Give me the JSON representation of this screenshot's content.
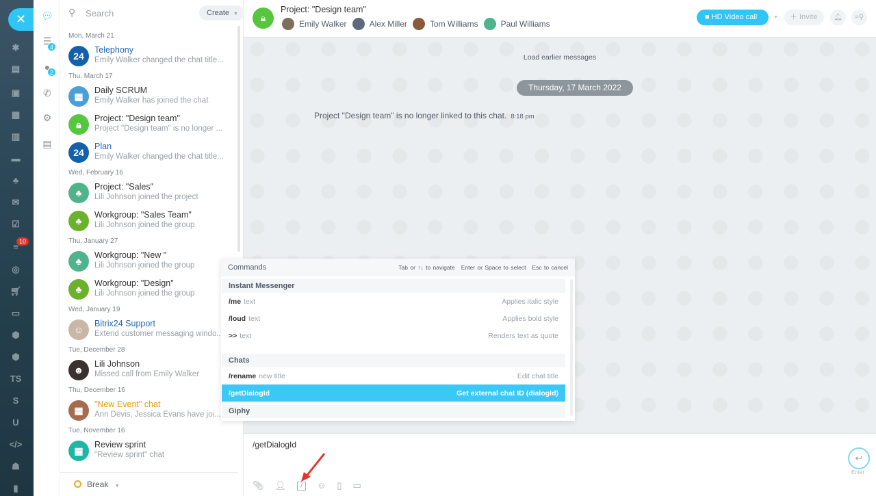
{
  "rail": {
    "close_icon": "close-icon",
    "badge": "10",
    "letters": [
      "TS",
      "S",
      "U"
    ]
  },
  "icon_column": {
    "items": [
      {
        "icon": "chat-icon"
      },
      {
        "icon": "notifications-icon",
        "count": "4"
      },
      {
        "icon": "openlines-icon",
        "count": "2"
      },
      {
        "icon": "phone-icon"
      },
      {
        "icon": "gear-icon"
      },
      {
        "icon": "export-icon"
      }
    ]
  },
  "list": {
    "search_placeholder": "Search",
    "create_label": "Create",
    "groups": [
      {
        "date": "Mon, March 21",
        "items": [
          {
            "title": "Telephony",
            "subtitle": "Emily Walker changed the chat title...",
            "avatar": "24",
            "color": "#1361ae",
            "title_style": "blue"
          }
        ]
      },
      {
        "date": "Thu, March 17",
        "items": [
          {
            "title": "Daily SCRUM",
            "subtitle": "Emily Walker has joined the chat",
            "avatar": "calendar",
            "color": "#4a9fd9"
          },
          {
            "title": "Project: \"Design team\"",
            "subtitle": "Project \"Design team\" is no longer ...",
            "avatar": "lock",
            "color": "#55c63d"
          },
          {
            "title": "Plan",
            "subtitle": "Emily Walker changed the chat title...",
            "avatar": "24",
            "color": "#1361ae",
            "title_style": "blue"
          }
        ]
      },
      {
        "date": "Wed, February 16",
        "items": [
          {
            "title": "Project: \"Sales\"",
            "subtitle": "Lili Johnson joined the project",
            "avatar": "group",
            "color": "#4fb38b"
          },
          {
            "title": "Workgroup: \"Sales Team\"",
            "subtitle": "Lili Johnson joined the group",
            "avatar": "group",
            "color": "#6ab22b"
          }
        ]
      },
      {
        "date": "Thu, January 27",
        "items": [
          {
            "title": "Workgroup: \"New \"",
            "subtitle": "Lili Johnson joined the group",
            "avatar": "group",
            "color": "#4fb38b"
          },
          {
            "title": "Workgroup: \"Design\"",
            "subtitle": "Lili Johnson joined the group",
            "avatar": "group",
            "color": "#6ab22b"
          }
        ]
      },
      {
        "date": "Wed, January 19",
        "items": [
          {
            "title": "Bitrix24 Support",
            "subtitle": "Extend customer messaging windo...",
            "avatar": "people",
            "color": "#c9b6a6",
            "title_style": "blue"
          }
        ]
      },
      {
        "date": "Tue, December 28",
        "items": [
          {
            "title": "Lili Johnson",
            "subtitle": "Missed call from Emily Walker",
            "avatar": "photo",
            "color": "#3a3230"
          }
        ]
      },
      {
        "date": "Thu, December 16",
        "items": [
          {
            "title": "\"New Event\" chat",
            "subtitle": "Ann Devis, Jessica Evans have joi...",
            "avatar": "calendar",
            "color": "#a66b4f",
            "title_style": "orange"
          }
        ]
      },
      {
        "date": "Tue, November 16",
        "items": [
          {
            "title": "Review sprint",
            "subtitle": "\"Review sprint\" chat",
            "avatar": "calendar",
            "color": "#1fb7a4"
          }
        ]
      }
    ],
    "status_label": "Break"
  },
  "header": {
    "title": "Project: \"Design team\"",
    "users": [
      {
        "name": "Emily Walker",
        "color": "#7d6e5e"
      },
      {
        "name": "Alex Miller",
        "color": "#5b6b7b"
      },
      {
        "name": "Tom Williams",
        "color": "#8a5a3c"
      },
      {
        "name": "Paul Williams",
        "color": "#4fb38b"
      }
    ],
    "video_call_label": "HD Video call",
    "invite_label": "Invite"
  },
  "chat": {
    "load_earlier": "Load earlier messages",
    "date_pill": "Thursday, 17 March 2022",
    "system_message": "Project \"Design team\" is no longer linked to this chat.",
    "system_time": "8:18 pm"
  },
  "commands": {
    "title": "Commands",
    "hints": [
      "Tab or ↑↓ to navigate",
      "Enter or Space to select",
      "Esc to cancel"
    ],
    "groups": [
      {
        "name": "Instant Messenger",
        "rows": [
          {
            "cmd": "/me",
            "arg": "text",
            "desc": "Applies italic style"
          },
          {
            "cmd": "/loud",
            "arg": "text",
            "desc": "Applies bold style"
          },
          {
            "cmd": ">>",
            "arg": "text",
            "desc": "Renders text as quote"
          }
        ]
      },
      {
        "name": "Chats",
        "rows": [
          {
            "cmd": "/rename",
            "arg": "new title",
            "desc": "Edit chat title"
          },
          {
            "cmd": "/getDialogId",
            "arg": "",
            "desc": "Get external chat ID (dialogId)",
            "selected": true
          }
        ]
      },
      {
        "name": "Giphy",
        "rows": []
      }
    ]
  },
  "input": {
    "value": "/getDialogId",
    "enter_label": "Enter"
  },
  "colors": {
    "accent": "#2fc6f6",
    "selected_row": "#3bc8f5",
    "annotation_arrow": "#e8322d"
  }
}
